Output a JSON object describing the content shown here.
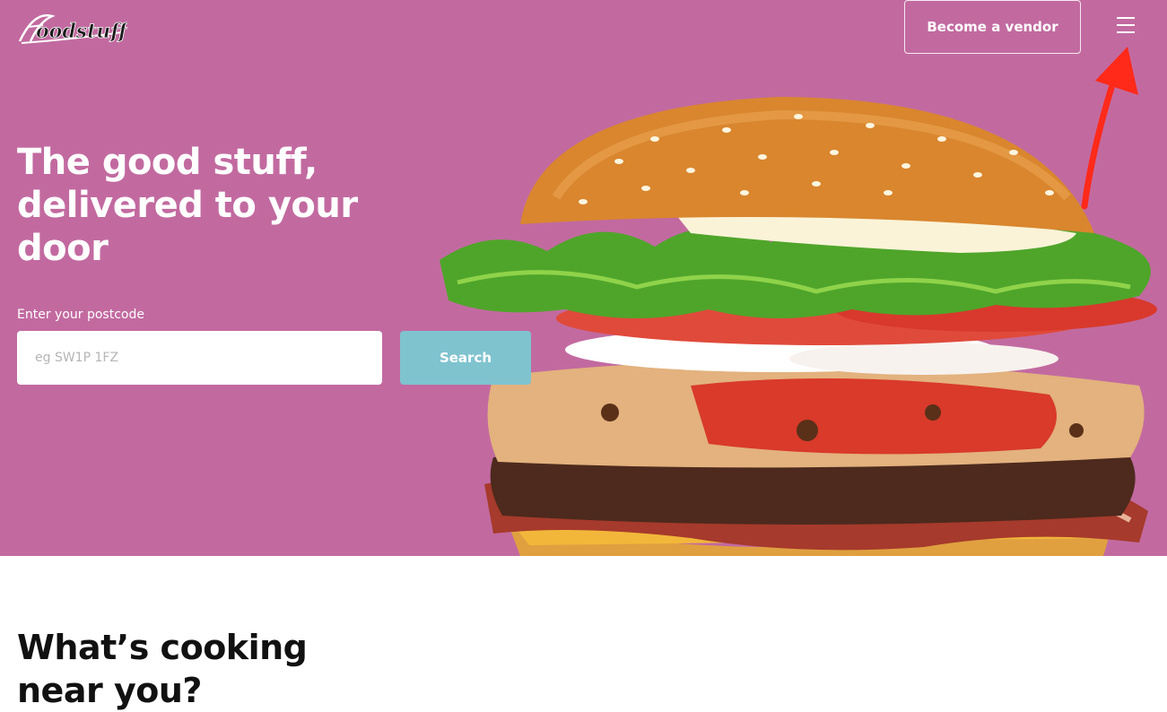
{
  "brand": {
    "logo_text": "Foodstuff",
    "hero_bg": "#c26aa0",
    "search_button_color": "#7fc3cf"
  },
  "header": {
    "vendor_button_label": "Become a vendor",
    "menu_icon": "hamburger-menu-icon"
  },
  "annotation": {
    "icon": "red-arrow-icon",
    "color": "#ff2a1a"
  },
  "hero": {
    "title": "The good stuff, delivered to your door",
    "image": "burger-image",
    "postcode": {
      "label": "Enter your postcode",
      "placeholder": "eg SW1P 1FZ",
      "value": ""
    },
    "search_button_label": "Search"
  },
  "section": {
    "title": "What’s cooking near you?"
  }
}
